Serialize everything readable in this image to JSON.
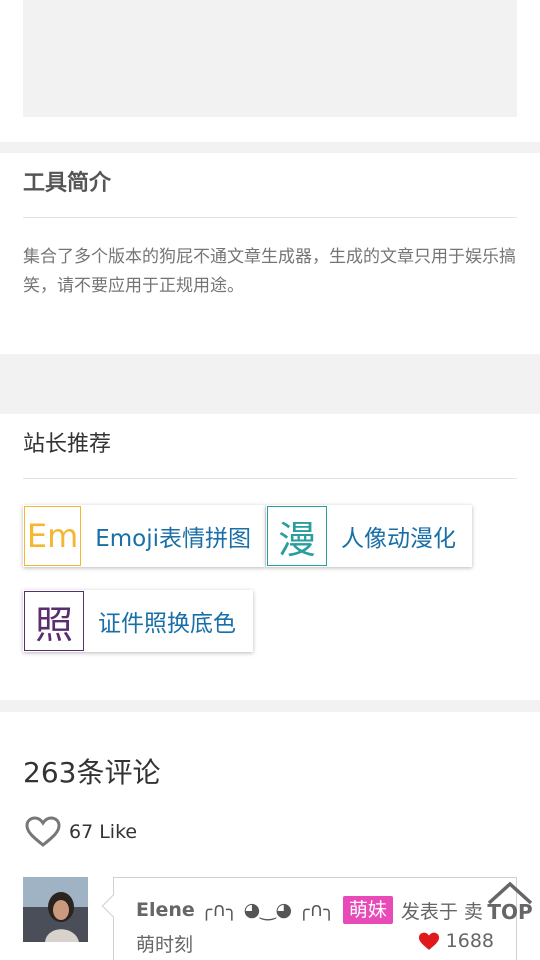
{
  "intro": {
    "title": "工具简介",
    "text": "集合了多个版本的狗屁不通文章生成器，生成的文章只用于娱乐搞笑，请不要应用于正规用途。"
  },
  "recommend": {
    "title": "站长推荐",
    "tools": [
      {
        "icon_text": "Em",
        "label": "Emoji表情拼图",
        "color": "#f5b731"
      },
      {
        "icon_text": "漫",
        "label": "人像动漫化",
        "color": "#2a9d9d"
      },
      {
        "icon_text": "照",
        "label": "证件照换底色",
        "color": "#5a2d6e"
      }
    ]
  },
  "comments": {
    "count_label": "263条评论",
    "like_icon": "heart-outline-icon",
    "like_label": "67 Like",
    "items": [
      {
        "author": "Elene",
        "kaomoji": "╭∩╮ ◕‿◕ ╭∩╮",
        "badge": "萌妹",
        "posted_prefix": "发表于 卖",
        "posted_suffix": "萌时刻",
        "likes": "1688",
        "badge_color": "#e84ab7",
        "likes_icon": "heart-filled-icon"
      }
    ]
  },
  "back_to_top": {
    "label": "TOP"
  }
}
